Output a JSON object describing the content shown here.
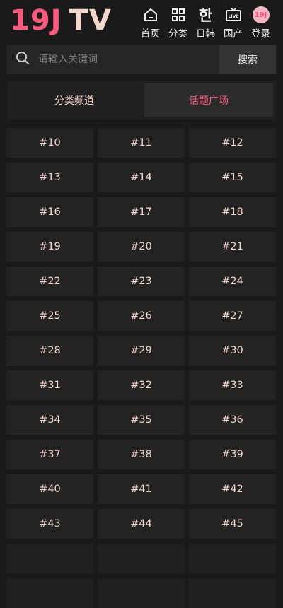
{
  "header": {
    "logo_part1": "19J",
    "logo_part2": "TV",
    "nav": [
      {
        "label": "首页",
        "icon": "home-icon"
      },
      {
        "label": "分类",
        "icon": "grid-icon"
      },
      {
        "label": "日韩",
        "icon": "korean-char-icon",
        "glyph": "한"
      },
      {
        "label": "国产",
        "icon": "live-tv-icon"
      },
      {
        "label": "登录",
        "icon": "avatar-icon",
        "glyph": "19J"
      }
    ]
  },
  "search": {
    "placeholder": "请输入关键词",
    "button": "搜索"
  },
  "tabs": [
    {
      "label": "分类频道",
      "active": false
    },
    {
      "label": "话题广场",
      "active": true
    }
  ],
  "topics": [
    "#10",
    "#11",
    "#12",
    "#13",
    "#14",
    "#15",
    "#16",
    "#17",
    "#18",
    "#19",
    "#20",
    "#21",
    "#22",
    "#23",
    "#24",
    "#25",
    "#26",
    "#27",
    "#28",
    "#29",
    "#30",
    "#31",
    "#32",
    "#33",
    "#34",
    "#35",
    "#36",
    "#37",
    "#38",
    "#39",
    "#40",
    "#41",
    "#42",
    "#43",
    "#44",
    "#45"
  ],
  "colors": {
    "accent": "#ff5a7e",
    "text_warm": "#f4d6cb",
    "background": "#1a1a1a",
    "cell": "#232323"
  }
}
